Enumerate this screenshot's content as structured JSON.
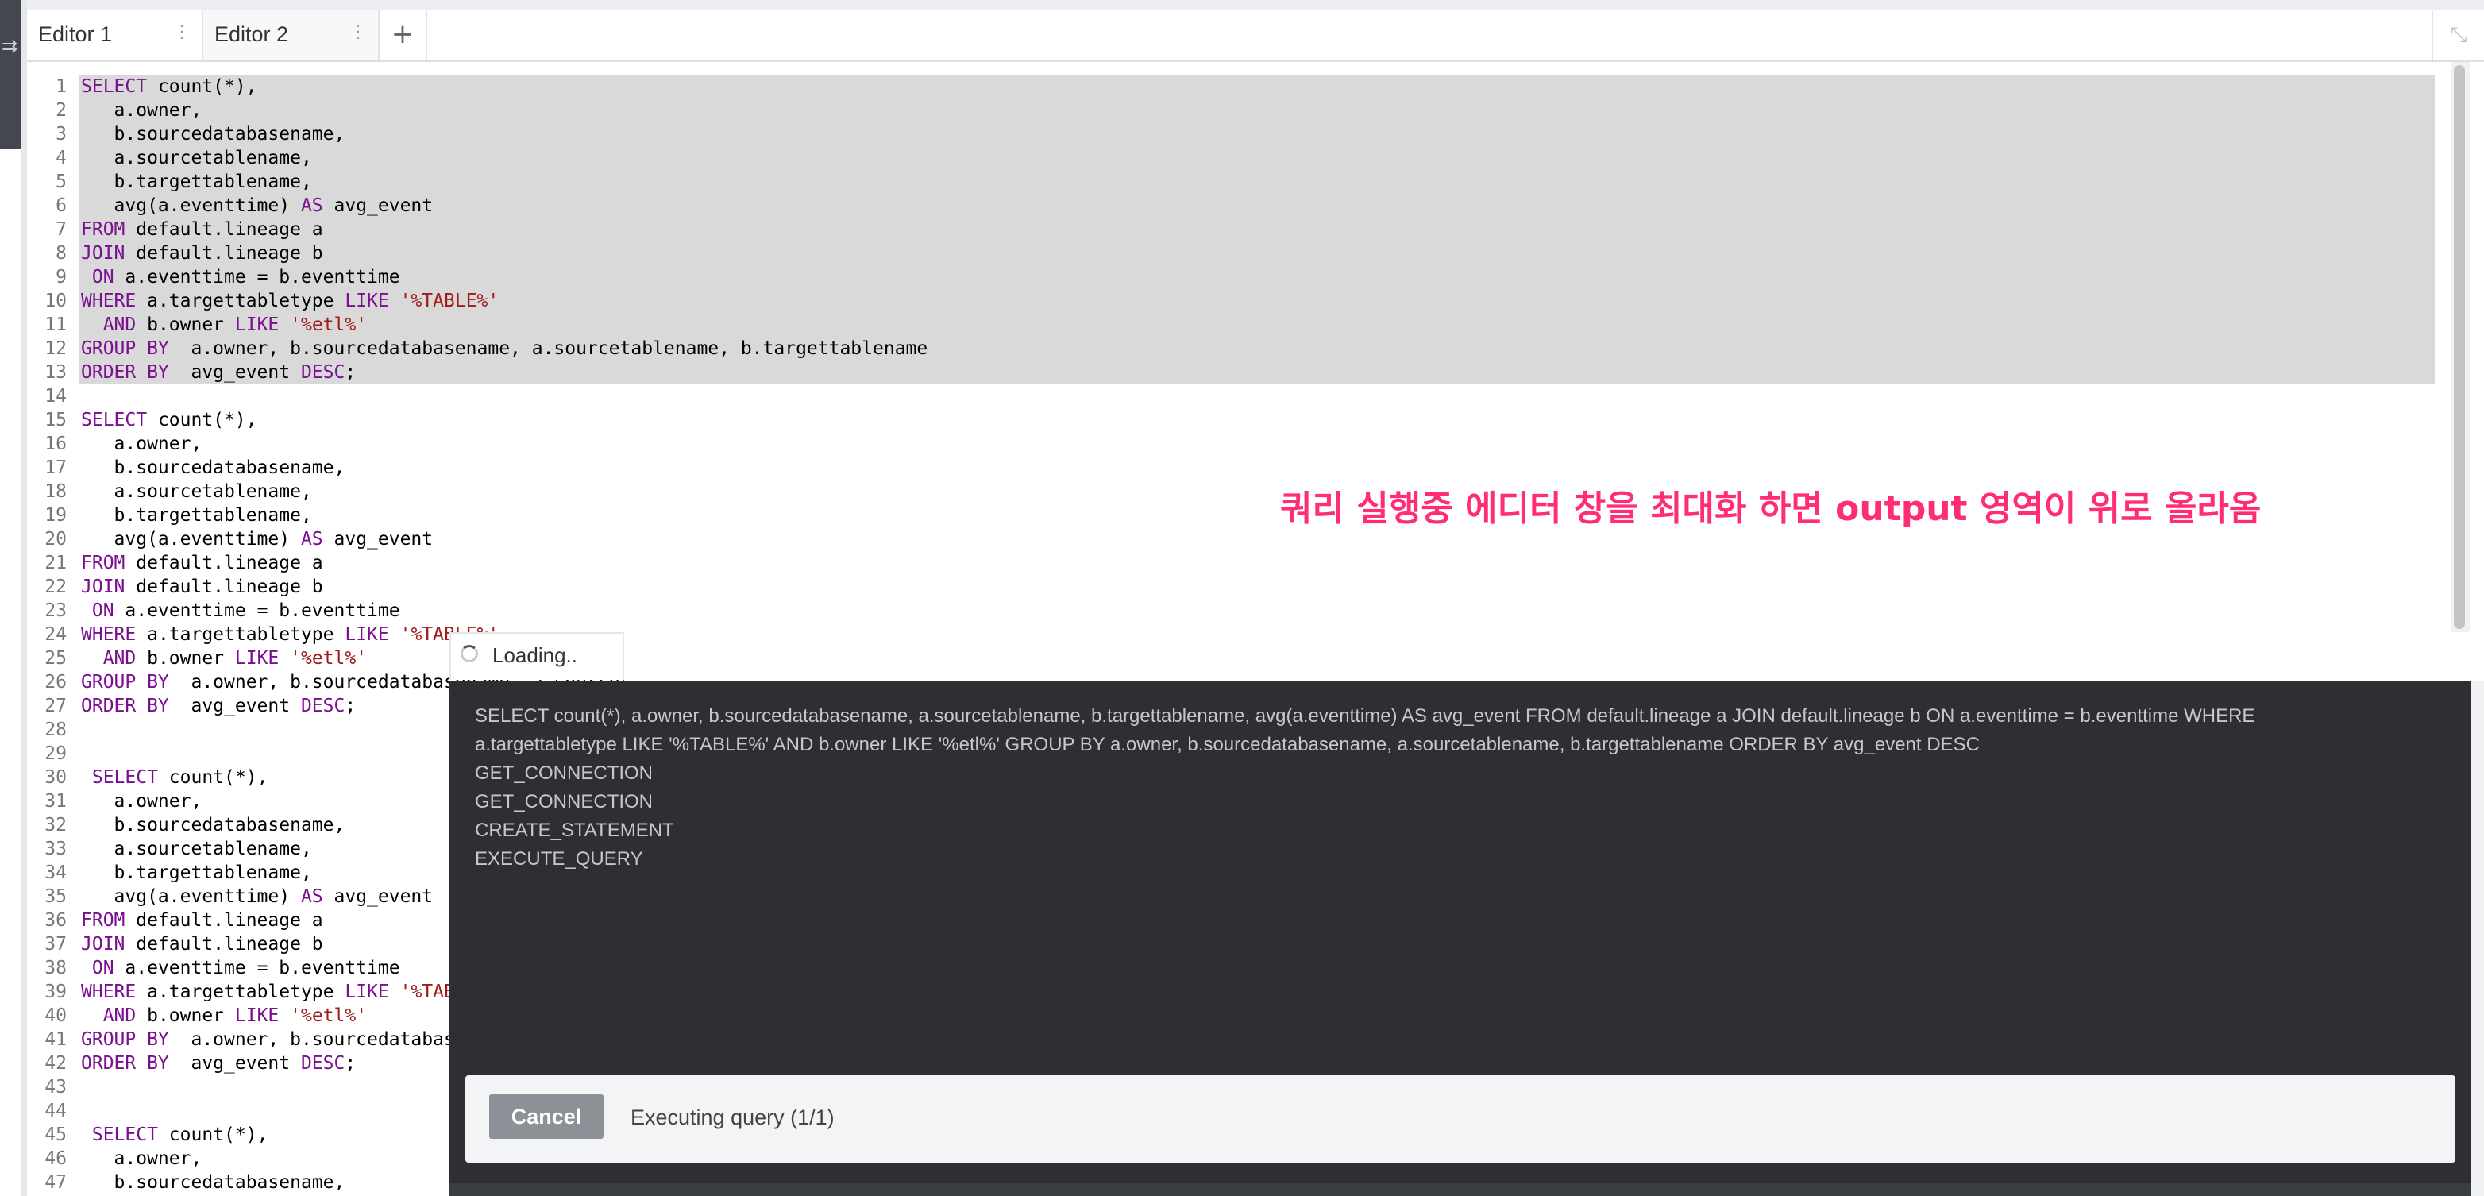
{
  "tabs": [
    {
      "label": "Editor 1",
      "active": true
    },
    {
      "label": "Editor 2",
      "active": false
    }
  ],
  "icons": {
    "add_tab": "+",
    "kebab": "⋮",
    "maximize": "⤡",
    "sidebar_toggle": "⇉"
  },
  "editor": {
    "lines": [
      {
        "n": "1",
        "code": [
          {
            "t": "SELECT",
            "c": "kw"
          },
          {
            "t": " count(*),",
            "c": ""
          }
        ]
      },
      {
        "n": "2",
        "code": [
          {
            "t": "   a.owner,",
            "c": ""
          }
        ]
      },
      {
        "n": "3",
        "code": [
          {
            "t": "   b.sourcedatabasename,",
            "c": ""
          }
        ]
      },
      {
        "n": "4",
        "code": [
          {
            "t": "   a.sourcetablename,",
            "c": ""
          }
        ]
      },
      {
        "n": "5",
        "code": [
          {
            "t": "   b.targettablename,",
            "c": ""
          }
        ]
      },
      {
        "n": "6",
        "code": [
          {
            "t": "   avg(a.eventtime) ",
            "c": ""
          },
          {
            "t": "AS",
            "c": "kw"
          },
          {
            "t": " avg_event",
            "c": ""
          }
        ]
      },
      {
        "n": "7",
        "code": [
          {
            "t": "FROM",
            "c": "kw"
          },
          {
            "t": " default.lineage a",
            "c": ""
          }
        ]
      },
      {
        "n": "8",
        "code": [
          {
            "t": "JOIN",
            "c": "kw"
          },
          {
            "t": " default.lineage b",
            "c": ""
          }
        ]
      },
      {
        "n": "9",
        "code": [
          {
            "t": " ",
            "c": ""
          },
          {
            "t": "ON",
            "c": "kw"
          },
          {
            "t": " a.eventtime = b.eventtime",
            "c": ""
          }
        ]
      },
      {
        "n": "10",
        "code": [
          {
            "t": "WHERE",
            "c": "kw"
          },
          {
            "t": " a.targettabletype ",
            "c": ""
          },
          {
            "t": "LIKE",
            "c": "kw"
          },
          {
            "t": " ",
            "c": ""
          },
          {
            "t": "'%TABLE%'",
            "c": "str"
          }
        ]
      },
      {
        "n": "11",
        "code": [
          {
            "t": "  ",
            "c": ""
          },
          {
            "t": "AND",
            "c": "kw"
          },
          {
            "t": " b.owner ",
            "c": ""
          },
          {
            "t": "LIKE",
            "c": "kw"
          },
          {
            "t": " ",
            "c": ""
          },
          {
            "t": "'%etl%'",
            "c": "str"
          }
        ]
      },
      {
        "n": "12",
        "code": [
          {
            "t": "GROUP BY",
            "c": "kw"
          },
          {
            "t": "  a.owner, b.sourcedatabasename, a.sourcetablename, b.targettablename",
            "c": ""
          }
        ]
      },
      {
        "n": "13",
        "code": [
          {
            "t": "ORDER BY",
            "c": "kw"
          },
          {
            "t": "  avg_event ",
            "c": ""
          },
          {
            "t": "DESC",
            "c": "kw"
          },
          {
            "t": ";",
            "c": ""
          }
        ]
      },
      {
        "n": "14",
        "code": []
      },
      {
        "n": "15",
        "code": [
          {
            "t": "SELECT",
            "c": "kw"
          },
          {
            "t": " count(*),",
            "c": ""
          }
        ]
      },
      {
        "n": "16",
        "code": [
          {
            "t": "   a.owner,",
            "c": ""
          }
        ]
      },
      {
        "n": "17",
        "code": [
          {
            "t": "   b.sourcedatabasename,",
            "c": ""
          }
        ]
      },
      {
        "n": "18",
        "code": [
          {
            "t": "   a.sourcetablename,",
            "c": ""
          }
        ]
      },
      {
        "n": "19",
        "code": [
          {
            "t": "   b.targettablename,",
            "c": ""
          }
        ]
      },
      {
        "n": "20",
        "code": [
          {
            "t": "   avg(a.eventtime) ",
            "c": ""
          },
          {
            "t": "AS",
            "c": "kw"
          },
          {
            "t": " avg_event",
            "c": ""
          }
        ]
      },
      {
        "n": "21",
        "code": [
          {
            "t": "FROM",
            "c": "kw"
          },
          {
            "t": " default.lineage a",
            "c": ""
          }
        ]
      },
      {
        "n": "22",
        "code": [
          {
            "t": "JOIN",
            "c": "kw"
          },
          {
            "t": " default.lineage b",
            "c": ""
          }
        ]
      },
      {
        "n": "23",
        "code": [
          {
            "t": " ",
            "c": ""
          },
          {
            "t": "ON",
            "c": "kw"
          },
          {
            "t": " a.eventtime = b.eventtime",
            "c": ""
          }
        ]
      },
      {
        "n": "24",
        "code": [
          {
            "t": "WHERE",
            "c": "kw"
          },
          {
            "t": " a.targettabletype ",
            "c": ""
          },
          {
            "t": "LIKE",
            "c": "kw"
          },
          {
            "t": " ",
            "c": ""
          },
          {
            "t": "'%TABLE%'",
            "c": "str"
          }
        ]
      },
      {
        "n": "25",
        "code": [
          {
            "t": "  ",
            "c": ""
          },
          {
            "t": "AND",
            "c": "kw"
          },
          {
            "t": " b.owner ",
            "c": ""
          },
          {
            "t": "LIKE",
            "c": "kw"
          },
          {
            "t": " ",
            "c": ""
          },
          {
            "t": "'%etl%'",
            "c": "str"
          }
        ]
      },
      {
        "n": "26",
        "code": [
          {
            "t": "GROUP BY",
            "c": "kw"
          },
          {
            "t": "  a.owner, b.sourcedatabasename, a.sourcetablename, b.targettablename",
            "c": ""
          }
        ]
      },
      {
        "n": "27",
        "code": [
          {
            "t": "ORDER BY",
            "c": "kw"
          },
          {
            "t": "  avg_event ",
            "c": ""
          },
          {
            "t": "DESC",
            "c": "kw"
          },
          {
            "t": ";",
            "c": ""
          }
        ]
      },
      {
        "n": "28",
        "code": []
      },
      {
        "n": "29",
        "code": []
      },
      {
        "n": "30",
        "code": [
          {
            "t": " ",
            "c": ""
          },
          {
            "t": "SELECT",
            "c": "kw"
          },
          {
            "t": " count(*),",
            "c": ""
          }
        ]
      },
      {
        "n": "31",
        "code": [
          {
            "t": "   a.owner,",
            "c": ""
          }
        ]
      },
      {
        "n": "32",
        "code": [
          {
            "t": "   b.sourcedatabasename,",
            "c": ""
          }
        ]
      },
      {
        "n": "33",
        "code": [
          {
            "t": "   a.sourcetablename,",
            "c": ""
          }
        ]
      },
      {
        "n": "34",
        "code": [
          {
            "t": "   b.targettablename,",
            "c": ""
          }
        ]
      },
      {
        "n": "35",
        "code": [
          {
            "t": "   avg(a.eventtime) ",
            "c": ""
          },
          {
            "t": "AS",
            "c": "kw"
          },
          {
            "t": " avg_event",
            "c": ""
          }
        ]
      },
      {
        "n": "36",
        "code": [
          {
            "t": "FROM",
            "c": "kw"
          },
          {
            "t": " default.lineage a",
            "c": ""
          }
        ]
      },
      {
        "n": "37",
        "code": [
          {
            "t": "JOIN",
            "c": "kw"
          },
          {
            "t": " default.lineage b",
            "c": ""
          }
        ]
      },
      {
        "n": "38",
        "code": [
          {
            "t": " ",
            "c": ""
          },
          {
            "t": "ON",
            "c": "kw"
          },
          {
            "t": " a.eventtime = b.eventtime",
            "c": ""
          }
        ]
      },
      {
        "n": "39",
        "code": [
          {
            "t": "WHERE",
            "c": "kw"
          },
          {
            "t": " a.targettabletype ",
            "c": ""
          },
          {
            "t": "LIKE",
            "c": "kw"
          },
          {
            "t": " ",
            "c": ""
          },
          {
            "t": "'%TABLE%'",
            "c": "str"
          }
        ]
      },
      {
        "n": "40",
        "code": [
          {
            "t": "  ",
            "c": ""
          },
          {
            "t": "AND",
            "c": "kw"
          },
          {
            "t": " b.owner ",
            "c": ""
          },
          {
            "t": "LIKE",
            "c": "kw"
          },
          {
            "t": " ",
            "c": ""
          },
          {
            "t": "'%etl%'",
            "c": "str"
          }
        ]
      },
      {
        "n": "41",
        "code": [
          {
            "t": "GROUP BY",
            "c": "kw"
          },
          {
            "t": "  a.owner, b.sourcedatabasename, a.sourcetablename, b.targettablename",
            "c": ""
          }
        ]
      },
      {
        "n": "42",
        "code": [
          {
            "t": "ORDER BY",
            "c": "kw"
          },
          {
            "t": "  avg_event ",
            "c": ""
          },
          {
            "t": "DESC",
            "c": "kw"
          },
          {
            "t": ";",
            "c": ""
          }
        ]
      },
      {
        "n": "43",
        "code": []
      },
      {
        "n": "44",
        "code": []
      },
      {
        "n": "45",
        "code": [
          {
            "t": " ",
            "c": ""
          },
          {
            "t": "SELECT",
            "c": "kw"
          },
          {
            "t": " count(*),",
            "c": ""
          }
        ]
      },
      {
        "n": "46",
        "code": [
          {
            "t": "   a.owner,",
            "c": ""
          }
        ]
      },
      {
        "n": "47",
        "code": [
          {
            "t": "   b.sourcedatabasename,",
            "c": ""
          }
        ]
      }
    ]
  },
  "annotation": "쿼리 실행중 에디터 창을 최대화 하면 output 영역이 위로 올라옴",
  "loading": {
    "label": "Loading.."
  },
  "output": {
    "log_lines": [
      "SELECT count(*), a.owner, b.sourcedatabasename, a.sourcetablename, b.targettablename, avg(a.eventtime) AS avg_event FROM default.lineage a JOIN default.lineage b ON a.eventtime = b.eventtime WHERE",
      "a.targettabletype LIKE '%TABLE%' AND b.owner LIKE '%etl%' GROUP BY a.owner, b.sourcedatabasename, a.sourcetablename, b.targettablename ORDER BY avg_event DESC",
      "GET_CONNECTION",
      "GET_CONNECTION",
      "CREATE_STATEMENT",
      "EXECUTE_QUERY"
    ],
    "cancel_label": "Cancel",
    "status": "Executing query (1/1)"
  },
  "colors": {
    "keyword": "#7a0f8f",
    "string": "#a11b1b",
    "annotation": "#ff2d78",
    "output_bg": "#2d2f33"
  }
}
